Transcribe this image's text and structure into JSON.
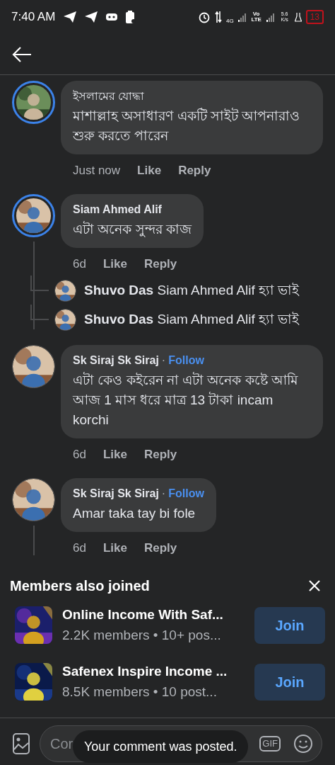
{
  "status_bar": {
    "time": "7:40 AM",
    "network": "4G",
    "volte": "Vo LTE",
    "speed": "5.6 K/s",
    "battery": "13",
    "battery_low": true
  },
  "comments": [
    {
      "author": "ইসলামের যোদ্ধা",
      "author_bold": false,
      "text": "মাশাল্লাহ অসাধারণ একটি সাইট আপনারাও শুরু করতে পারেন",
      "ring": true,
      "time": "Just now",
      "like": "Like",
      "reply": "Reply",
      "thread_line": false
    },
    {
      "author": "Siam Ahmed Alif",
      "author_bold": true,
      "text": "এটা অনেক সুন্দর কাজ",
      "ring": true,
      "time": "6d",
      "like": "Like",
      "reply": "Reply",
      "thread_line": true,
      "replies": [
        {
          "author": "Shuvo Das",
          "text": "Siam Ahmed Alif হ্যা ভাই"
        },
        {
          "author": "Shuvo Das",
          "text": "Siam Ahmed Alif হ্যা ভাই"
        }
      ]
    },
    {
      "author": "Sk Siraj Sk Siraj",
      "author_bold": true,
      "text": "এটা কেও কইরেন না এটা অনেক কষ্টে আমি আজ 1 মাস ধরে মাত্র 13 টাকা incam korchi",
      "ring": false,
      "separator": "·",
      "follow": "Follow",
      "time": "6d",
      "like": "Like",
      "reply": "Reply",
      "thread_line": false
    },
    {
      "author": "Sk Siraj Sk Siraj",
      "author_bold": true,
      "text": "Amar taka tay bi fole",
      "ring": false,
      "separator": "·",
      "follow": "Follow",
      "time": "6d",
      "like": "Like",
      "reply": "Reply",
      "thread_line": true
    }
  ],
  "members_also_joined": {
    "title": "Members also joined",
    "groups": [
      {
        "name": "Online Income With Saf...",
        "meta": "2.2K members • 10+ pos...",
        "action": "Join"
      },
      {
        "name": "Safenex Inspire Income ...",
        "meta": "8.5K members • 10 post...",
        "action": "Join"
      }
    ]
  },
  "composer": {
    "placeholder": "Cor",
    "gif": "GIF"
  },
  "toast": "Your comment was posted."
}
